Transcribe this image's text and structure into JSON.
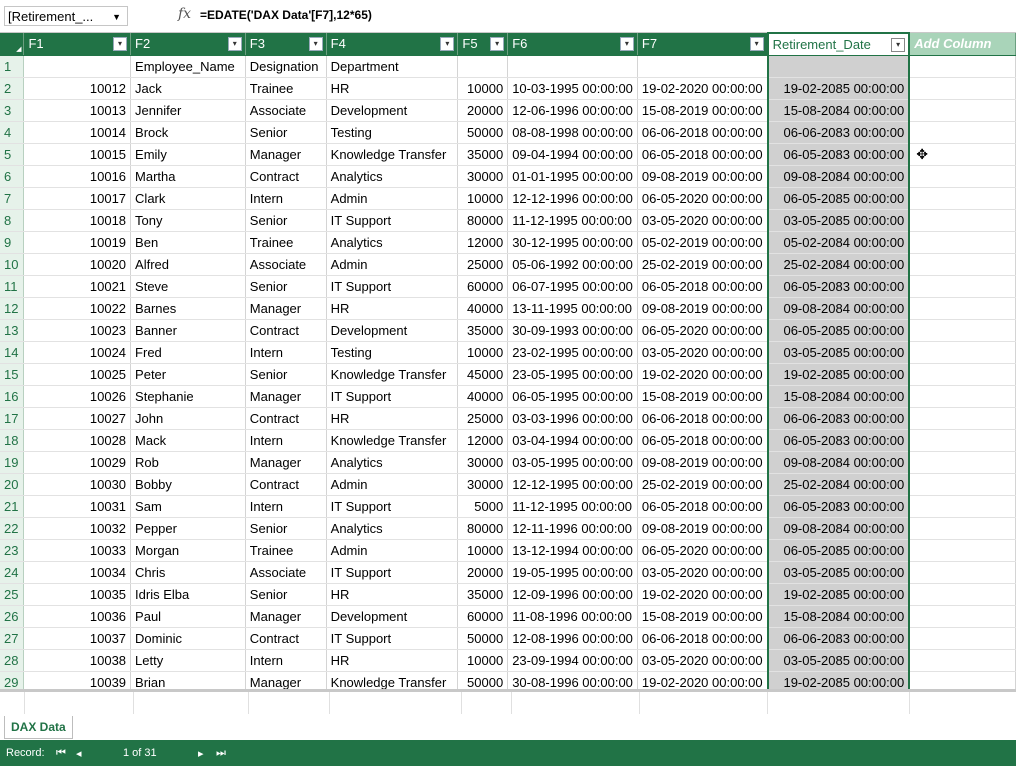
{
  "formula_bar": {
    "name_box": "[Retirement_...",
    "fx": "fx",
    "formula": "=EDATE('DAX Data'[F7],12*65)"
  },
  "columns": [
    {
      "label": "F1"
    },
    {
      "label": "F2"
    },
    {
      "label": "F3"
    },
    {
      "label": "F4"
    },
    {
      "label": "F5"
    },
    {
      "label": "F6"
    },
    {
      "label": "F7"
    },
    {
      "label": "Retirement_Date"
    },
    {
      "label": "Add Column"
    }
  ],
  "rows": [
    {
      "n": "1",
      "c": [
        "",
        "Employee_Name",
        "Designation",
        "Department",
        "",
        "",
        "",
        ""
      ]
    },
    {
      "n": "2",
      "c": [
        "10012",
        "Jack",
        "Trainee",
        "HR",
        "10000",
        "10-03-1995 00:00:00",
        "19-02-2020 00:00:00",
        "19-02-2085 00:00:00"
      ]
    },
    {
      "n": "3",
      "c": [
        "10013",
        "Jennifer",
        "Associate",
        "Development",
        "20000",
        "12-06-1996 00:00:00",
        "15-08-2019 00:00:00",
        "15-08-2084 00:00:00"
      ]
    },
    {
      "n": "4",
      "c": [
        "10014",
        "Brock",
        "Senior",
        "Testing",
        "50000",
        "08-08-1998 00:00:00",
        "06-06-2018 00:00:00",
        "06-06-2083 00:00:00"
      ]
    },
    {
      "n": "5",
      "c": [
        "10015",
        "Emily",
        "Manager",
        "Knowledge Transfer",
        "35000",
        "09-04-1994 00:00:00",
        "06-05-2018 00:00:00",
        "06-05-2083 00:00:00"
      ]
    },
    {
      "n": "6",
      "c": [
        "10016",
        "Martha",
        "Contract",
        "Analytics",
        "30000",
        "01-01-1995 00:00:00",
        "09-08-2019 00:00:00",
        "09-08-2084 00:00:00"
      ]
    },
    {
      "n": "7",
      "c": [
        "10017",
        "Clark",
        "Intern",
        "Admin",
        "10000",
        "12-12-1996 00:00:00",
        "06-05-2020 00:00:00",
        "06-05-2085 00:00:00"
      ]
    },
    {
      "n": "8",
      "c": [
        "10018",
        "Tony",
        "Senior",
        "IT Support",
        "80000",
        "11-12-1995 00:00:00",
        "03-05-2020 00:00:00",
        "03-05-2085 00:00:00"
      ]
    },
    {
      "n": "9",
      "c": [
        "10019",
        "Ben",
        "Trainee",
        "Analytics",
        "12000",
        "30-12-1995 00:00:00",
        "05-02-2019 00:00:00",
        "05-02-2084 00:00:00"
      ]
    },
    {
      "n": "10",
      "c": [
        "10020",
        "Alfred",
        "Associate",
        "Admin",
        "25000",
        "05-06-1992 00:00:00",
        "25-02-2019 00:00:00",
        "25-02-2084 00:00:00"
      ]
    },
    {
      "n": "11",
      "c": [
        "10021",
        "Steve",
        "Senior",
        "IT Support",
        "60000",
        "06-07-1995 00:00:00",
        "06-05-2018 00:00:00",
        "06-05-2083 00:00:00"
      ]
    },
    {
      "n": "12",
      "c": [
        "10022",
        "Barnes",
        "Manager",
        "HR",
        "40000",
        "13-11-1995 00:00:00",
        "09-08-2019 00:00:00",
        "09-08-2084 00:00:00"
      ]
    },
    {
      "n": "13",
      "c": [
        "10023",
        "Banner",
        "Contract",
        "Development",
        "35000",
        "30-09-1993 00:00:00",
        "06-05-2020 00:00:00",
        "06-05-2085 00:00:00"
      ]
    },
    {
      "n": "14",
      "c": [
        "10024",
        "Fred",
        "Intern",
        "Testing",
        "10000",
        "23-02-1995 00:00:00",
        "03-05-2020 00:00:00",
        "03-05-2085 00:00:00"
      ]
    },
    {
      "n": "15",
      "c": [
        "10025",
        "Peter",
        "Senior",
        "Knowledge Transfer",
        "45000",
        "23-05-1995 00:00:00",
        "19-02-2020 00:00:00",
        "19-02-2085 00:00:00"
      ]
    },
    {
      "n": "16",
      "c": [
        "10026",
        "Stephanie",
        "Manager",
        "IT Support",
        "40000",
        "06-05-1995 00:00:00",
        "15-08-2019 00:00:00",
        "15-08-2084 00:00:00"
      ]
    },
    {
      "n": "17",
      "c": [
        "10027",
        "John",
        "Contract",
        "HR",
        "25000",
        "03-03-1996 00:00:00",
        "06-06-2018 00:00:00",
        "06-06-2083 00:00:00"
      ]
    },
    {
      "n": "18",
      "c": [
        "10028",
        "Mack",
        "Intern",
        "Knowledge Transfer",
        "12000",
        "03-04-1994 00:00:00",
        "06-05-2018 00:00:00",
        "06-05-2083 00:00:00"
      ]
    },
    {
      "n": "19",
      "c": [
        "10029",
        "Rob",
        "Manager",
        "Analytics",
        "30000",
        "03-05-1995 00:00:00",
        "09-08-2019 00:00:00",
        "09-08-2084 00:00:00"
      ]
    },
    {
      "n": "20",
      "c": [
        "10030",
        "Bobby",
        "Contract",
        "Admin",
        "30000",
        "12-12-1995 00:00:00",
        "25-02-2019 00:00:00",
        "25-02-2084 00:00:00"
      ]
    },
    {
      "n": "21",
      "c": [
        "10031",
        "Sam",
        "Intern",
        "IT Support",
        "5000",
        "11-12-1995 00:00:00",
        "06-05-2018 00:00:00",
        "06-05-2083 00:00:00"
      ]
    },
    {
      "n": "22",
      "c": [
        "10032",
        "Pepper",
        "Senior",
        "Analytics",
        "80000",
        "12-11-1996 00:00:00",
        "09-08-2019 00:00:00",
        "09-08-2084 00:00:00"
      ]
    },
    {
      "n": "23",
      "c": [
        "10033",
        "Morgan",
        "Trainee",
        "Admin",
        "10000",
        "13-12-1994 00:00:00",
        "06-05-2020 00:00:00",
        "06-05-2085 00:00:00"
      ]
    },
    {
      "n": "24",
      "c": [
        "10034",
        "Chris",
        "Associate",
        "IT Support",
        "20000",
        "19-05-1995 00:00:00",
        "03-05-2020 00:00:00",
        "03-05-2085 00:00:00"
      ]
    },
    {
      "n": "25",
      "c": [
        "10035",
        "Idris Elba",
        "Senior",
        "HR",
        "35000",
        "12-09-1996 00:00:00",
        "19-02-2020 00:00:00",
        "19-02-2085 00:00:00"
      ]
    },
    {
      "n": "26",
      "c": [
        "10036",
        "Paul",
        "Manager",
        "Development",
        "60000",
        "11-08-1996 00:00:00",
        "15-08-2019 00:00:00",
        "15-08-2084 00:00:00"
      ]
    },
    {
      "n": "27",
      "c": [
        "10037",
        "Dominic",
        "Contract",
        "IT Support",
        "50000",
        "12-08-1996 00:00:00",
        "06-06-2018 00:00:00",
        "06-06-2083 00:00:00"
      ]
    },
    {
      "n": "28",
      "c": [
        "10038",
        "Letty",
        "Intern",
        "HR",
        "10000",
        "23-09-1994 00:00:00",
        "03-05-2020 00:00:00",
        "03-05-2085 00:00:00"
      ]
    },
    {
      "n": "29",
      "c": [
        "10039",
        "Brian",
        "Manager",
        "Knowledge Transfer",
        "50000",
        "30-08-1996 00:00:00",
        "19-02-2020 00:00:00",
        "19-02-2085 00:00:00"
      ]
    }
  ],
  "sheet_tab": "DAX Data",
  "status": {
    "record_label": "Record:",
    "position": "1 of 31"
  },
  "colors": {
    "accent": "#217346",
    "calc_column_bg": "#d0d0d0",
    "add_column_bg": "#a9d4b9"
  }
}
